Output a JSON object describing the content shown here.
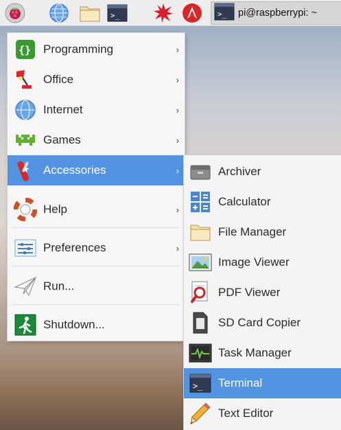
{
  "panel": {
    "icons": [
      "raspberry-logo-icon",
      "globe-icon",
      "folder-icon",
      "terminal-icon",
      "burst-icon",
      "wolfram-icon"
    ],
    "task_label": "pi@raspberrypi: ~"
  },
  "main_menu": {
    "items": [
      {
        "label": "Programming",
        "icon": "braces-icon",
        "submenu": true
      },
      {
        "label": "Office",
        "icon": "desk-lamp-icon",
        "submenu": true
      },
      {
        "label": "Internet",
        "icon": "globe-icon",
        "submenu": true
      },
      {
        "label": "Games",
        "icon": "space-invader-icon",
        "submenu": true
      },
      {
        "label": "Accessories",
        "icon": "swiss-knife-icon",
        "submenu": true,
        "selected": true
      },
      {
        "label": "Help",
        "icon": "lifebuoy-icon",
        "submenu": true
      },
      {
        "label": "Preferences",
        "icon": "sliders-icon",
        "submenu": true
      },
      {
        "label": "Run...",
        "icon": "paper-plane-icon",
        "submenu": false
      },
      {
        "label": "Shutdown...",
        "icon": "running-man-icon",
        "submenu": false
      }
    ],
    "arrow": "›"
  },
  "accessories_menu": {
    "items": [
      {
        "label": "Archiver",
        "icon": "archive-icon"
      },
      {
        "label": "Calculator",
        "icon": "calculator-icon"
      },
      {
        "label": "File Manager",
        "icon": "folder-icon"
      },
      {
        "label": "Image Viewer",
        "icon": "image-icon"
      },
      {
        "label": "PDF Viewer",
        "icon": "pdf-magnifier-icon"
      },
      {
        "label": "SD Card Copier",
        "icon": "sd-card-icon"
      },
      {
        "label": "Task Manager",
        "icon": "task-monitor-icon"
      },
      {
        "label": "Terminal",
        "icon": "terminal-icon",
        "selected": true
      },
      {
        "label": "Text Editor",
        "icon": "pencil-icon"
      }
    ]
  },
  "colors": {
    "selection": "#5294e2",
    "menu_bg": "#f6f6f6",
    "panel_bg": "#ededed"
  }
}
